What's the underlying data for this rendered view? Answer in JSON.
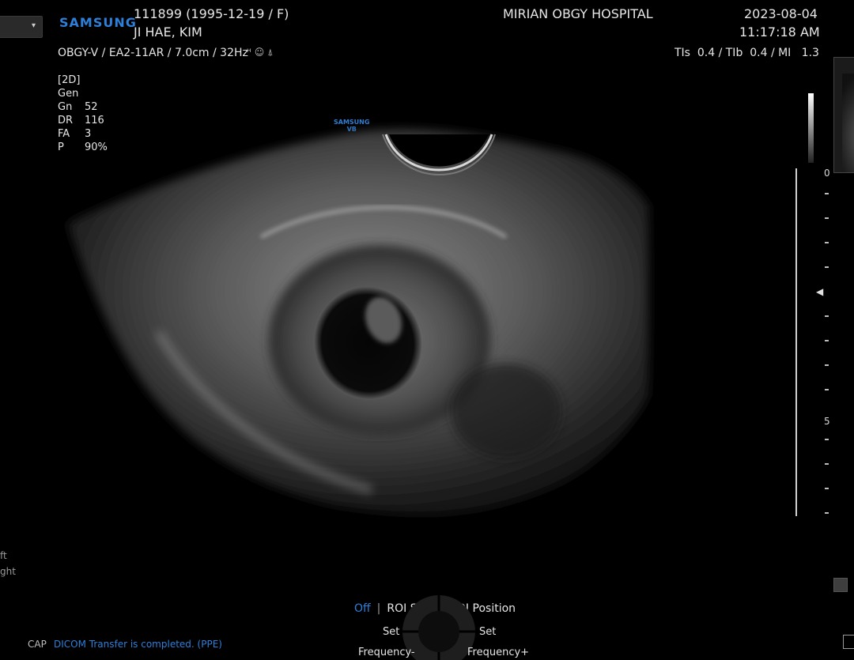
{
  "header": {
    "dropdown_arrow": "▾",
    "logo": "SAMSUNG",
    "patient_id": "111899 (1995-12-19 / F)",
    "patient_name": "JI HAE, KIM",
    "hospital": "MIRIAN OBGY HOSPITAL",
    "date": "2023-08-04",
    "time": "11:17:18 AM"
  },
  "probe": {
    "info": "OBGY-V / EA2-11AR / 7.0cm / 32Hz",
    "icons": [
      "harmonic-icon",
      "baby-face-icon",
      "cone-beam-icon"
    ],
    "thermal": "TIs  0.4 / TIb  0.4 / MI   1.3"
  },
  "params": {
    "mode": "[2D]",
    "preset": "Gen",
    "rows": [
      {
        "label": "Gn",
        "value": "52"
      },
      {
        "label": "DR",
        "value": "116"
      },
      {
        "label": "FA",
        "value": "3"
      },
      {
        "label": "P",
        "value": "90%"
      }
    ]
  },
  "vb_logo": {
    "line1": "SAMSUNG",
    "line2": "VB"
  },
  "depth_scale": {
    "top_label": "0",
    "mid_label": "5",
    "focus_marker": "◀"
  },
  "side_labels": {
    "left_1": "ft",
    "left_2": "ght"
  },
  "menu": {
    "off": "Off",
    "sep": "|",
    "roi_size": "ROI Size",
    "roi_position": "ROI Position",
    "set_left": "Set",
    "set_right": "Set",
    "freq_minus": "Frequency-",
    "freq_plus": "Frequency+"
  },
  "status": {
    "cap": "CAP",
    "message": "DICOM Transfer is completed. (PPE)"
  },
  "colors": {
    "accent_blue": "#2e7fd8",
    "background": "#000000"
  }
}
